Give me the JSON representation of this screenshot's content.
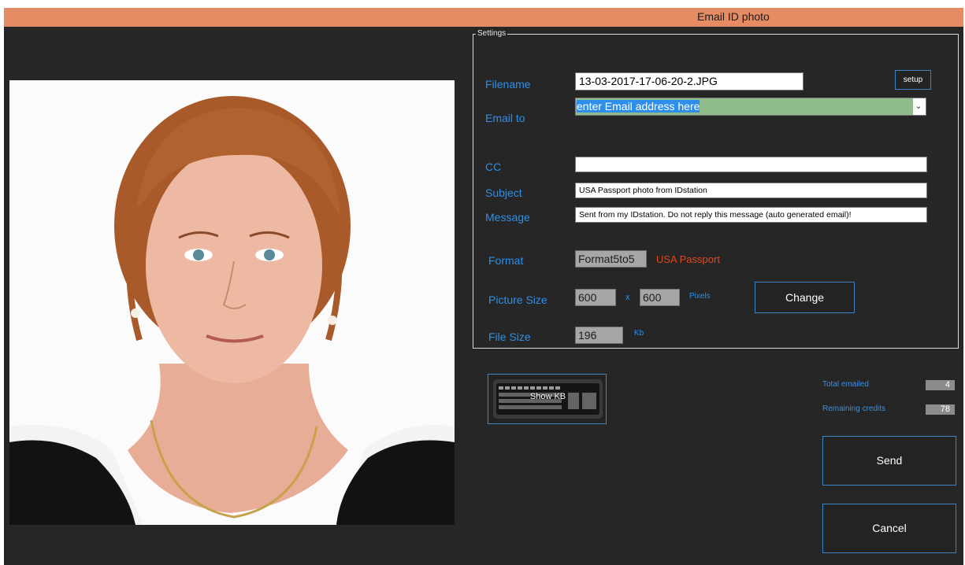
{
  "window": {
    "title": "Email ID photo"
  },
  "settings": {
    "legend": "Settings",
    "filename_label": "Filename",
    "filename_value": "13-03-2017-17-06-20-2.JPG",
    "setup_button": "setup",
    "email_label": "Email to",
    "email_value": "enter Email address here",
    "cc_label": "CC",
    "cc_value": "",
    "subject_label": "Subject",
    "subject_value": "USA Passport photo from IDstation",
    "message_label": "Message",
    "message_value": "Sent from my IDstation. Do not reply this message (auto generated email)!",
    "format_label": "Format",
    "format_value": "Format5to5",
    "format_name": "USA Passport",
    "picture_size_label": "Picture Size",
    "width_value": "600",
    "x_sep": "x",
    "height_value": "600",
    "pixels_unit": "Pixels",
    "change_button": "Change",
    "file_size_label": "File Size",
    "file_size_value": "196",
    "kb_unit": "Kb"
  },
  "keyboard_button": {
    "label": "Show KB",
    "icon": "keyboard-icon"
  },
  "stats": {
    "total_emailed_label": "Total emailed",
    "total_emailed_value": "4",
    "remaining_credits_label": "Remaining credits",
    "remaining_credits_value": "78"
  },
  "actions": {
    "send": "Send",
    "cancel": "Cancel"
  },
  "colors": {
    "titlebar": "#e58c64",
    "background": "#262626",
    "label_blue": "#2f8fe8",
    "format_name": "#e0471e",
    "email_field": "#8fbc8a"
  }
}
